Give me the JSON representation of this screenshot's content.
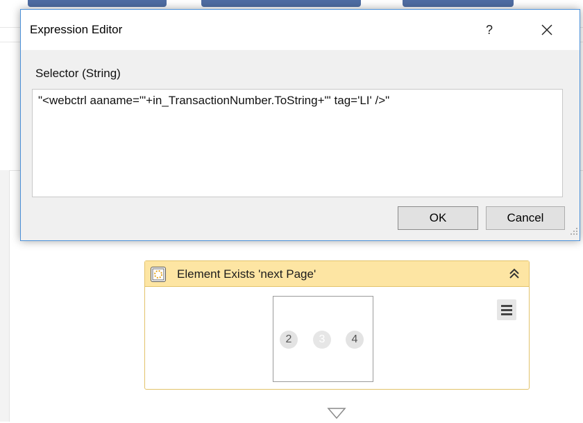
{
  "dialog": {
    "title": "Expression Editor",
    "help_label": "?",
    "field_label": "Selector (String)",
    "expression": "\"<webctrl aaname='\"+in_TransactionNumber.ToString+\"' tag='LI' />\"",
    "ok_label": "OK",
    "cancel_label": "Cancel"
  },
  "activity": {
    "title": "Element Exists 'next Page'",
    "preview_pages": [
      "2",
      "3",
      "4"
    ],
    "header_color": "#fde5a3",
    "border_color": "#e2c26a"
  },
  "icons": {
    "activity": "element-exists-icon",
    "collapse": "double-chevron-up-icon",
    "menu": "hamburger-menu-icon",
    "close": "close-icon",
    "flow": "down-triangle-icon"
  },
  "colors": {
    "dialog_border": "#4a90d9"
  }
}
